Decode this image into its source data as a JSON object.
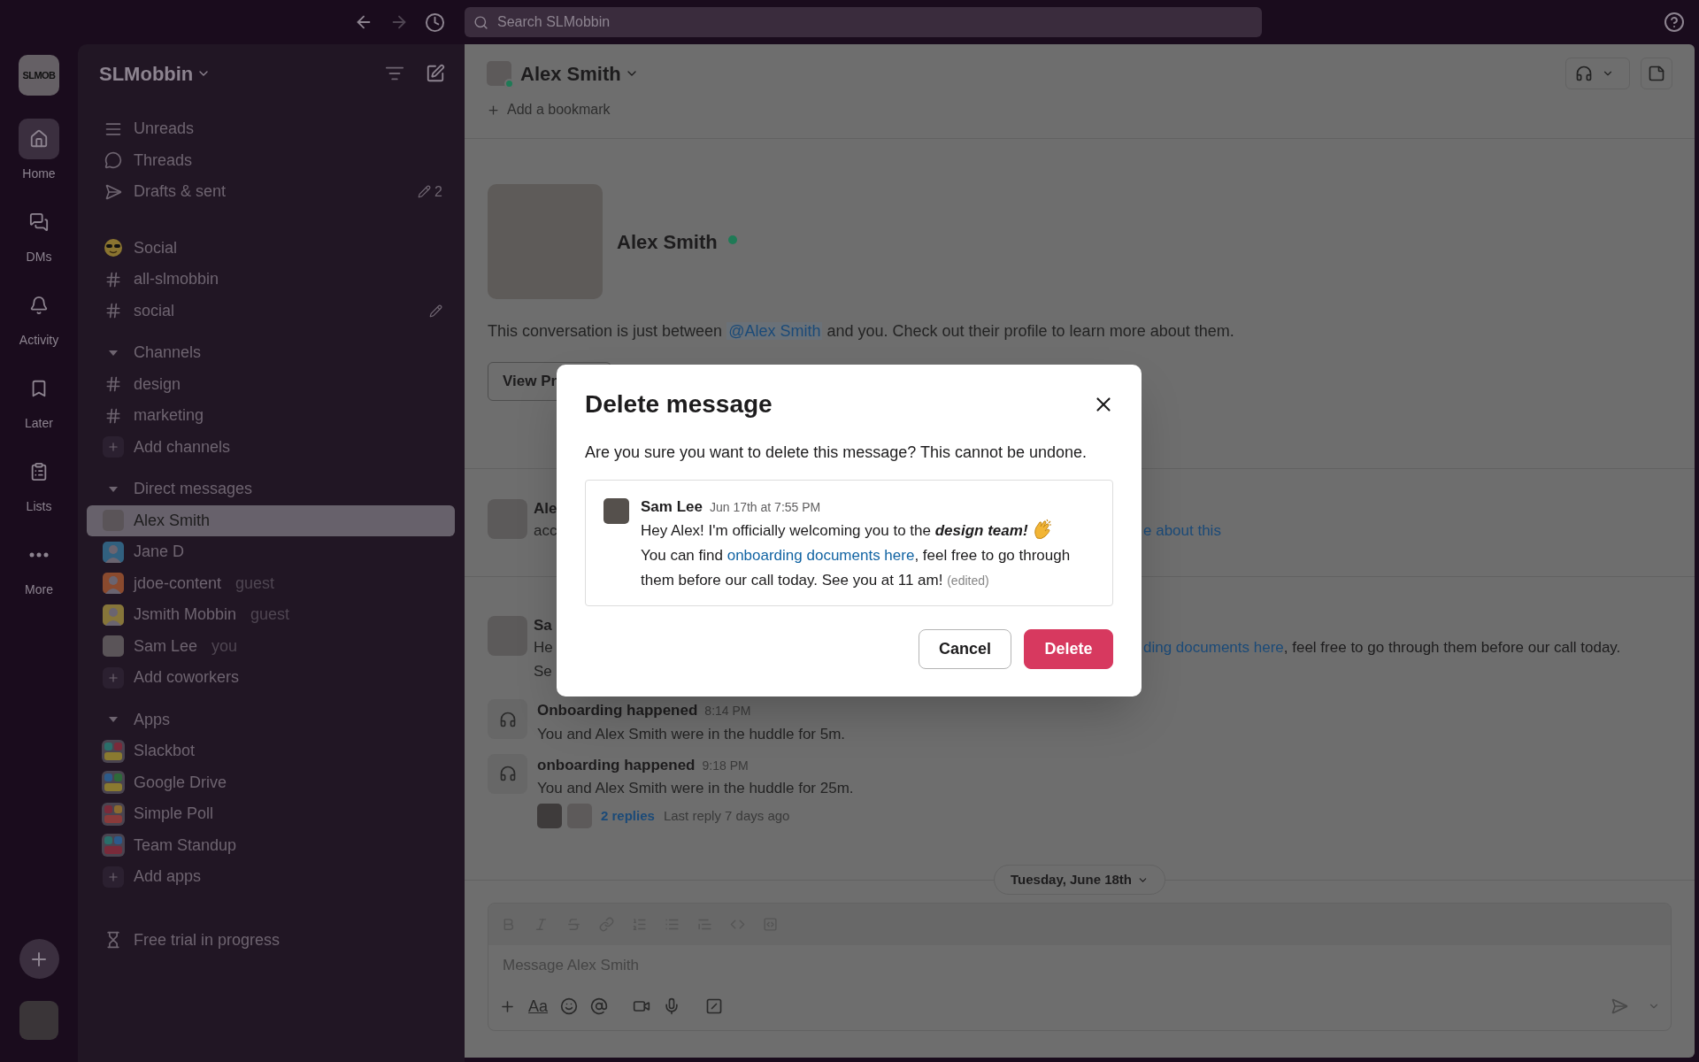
{
  "top_bar": {
    "search": {
      "placeholder": "Search SLMobbin"
    }
  },
  "rail": {
    "workspace_logo": "SLMOB",
    "items": [
      {
        "label": "Home",
        "selected": true
      },
      {
        "label": "DMs",
        "selected": false
      },
      {
        "label": "Activity",
        "selected": false
      },
      {
        "label": "Later",
        "selected": false
      },
      {
        "label": "Lists",
        "selected": false
      },
      {
        "label": "More",
        "selected": false
      }
    ]
  },
  "sidebar": {
    "workspace": "SLMobbin",
    "nav": [
      {
        "label": "Unreads",
        "selected": false
      },
      {
        "label": "Threads",
        "selected": false
      },
      {
        "label": "Drafts & sent",
        "count": "2",
        "selected": false
      }
    ],
    "starred": [
      {
        "kind": "emoji",
        "label": "Social",
        "selected": false
      },
      {
        "kind": "channel",
        "label": "all-slmobbin",
        "selected": false
      },
      {
        "kind": "channel",
        "label": "social",
        "draft": true,
        "selected": false
      }
    ],
    "sections": [
      {
        "title": "Channels",
        "expanded": true,
        "items": [
          {
            "kind": "channel",
            "label": "design",
            "selected": false
          },
          {
            "kind": "channel",
            "label": "marketing",
            "selected": false
          },
          {
            "kind": "add",
            "label": "Add channels",
            "selected": false
          }
        ]
      },
      {
        "title": "Direct messages",
        "expanded": true,
        "items": [
          {
            "kind": "person",
            "label": "Alex Smith",
            "selected": true
          },
          {
            "kind": "person",
            "label": "Jane D",
            "color": "#31607f",
            "selected": false
          },
          {
            "kind": "person",
            "label": "jdoe-content",
            "tag": "guest",
            "color": "#8a4a2e",
            "selected": false
          },
          {
            "kind": "person",
            "label": "Jsmith Mobbin",
            "tag": "guest",
            "color": "#86753a",
            "selected": false
          },
          {
            "kind": "person",
            "label": "Sam Lee",
            "tag": "you",
            "selected": false
          },
          {
            "kind": "add",
            "label": "Add coworkers",
            "selected": false
          }
        ]
      },
      {
        "title": "Apps",
        "expanded": true,
        "items": [
          {
            "kind": "app",
            "label": "Slackbot",
            "selected": false
          },
          {
            "kind": "app",
            "label": "Google Drive",
            "selected": false
          },
          {
            "kind": "app",
            "label": "Simple Poll",
            "selected": false
          },
          {
            "kind": "app",
            "label": "Team Standup",
            "selected": false
          },
          {
            "kind": "add",
            "label": "Add apps",
            "selected": false
          }
        ]
      }
    ],
    "footer": "Free trial in progress"
  },
  "conversation": {
    "header": {
      "title": "Alex Smith",
      "online": true
    },
    "bookmark": "Add a bookmark",
    "profile": {
      "name": "Alex Smith",
      "online": true,
      "intro_start": "This conversation is just between ",
      "mention": "@Alex Smith",
      "intro_end": " and you. Check out their profile to learn more about them.",
      "button": "View Pr"
    },
    "messages": [
      {
        "author": "Ale",
        "lines": [
          "acc"
        ],
        "right_link": "e about this"
      },
      {
        "author": "Sa",
        "lines": [
          "He",
          "Se"
        ],
        "right_link": "ding documents here",
        "right_text": ", feel free to go through them before our call today."
      }
    ],
    "huddles": [
      {
        "title": "Onboarding happened",
        "time": "8:14 PM",
        "text": "You and Alex Smith were in the huddle for 5m."
      },
      {
        "title": "onboarding happened",
        "time": "9:18 PM",
        "text": "You and Alex Smith were in the huddle for 25m.",
        "replies": "2 replies",
        "last_reply": "Last reply 7 days ago"
      }
    ],
    "date_divider": "Tuesday, June 18th",
    "composer": {
      "placeholder": "Message Alex Smith",
      "format_label": "Aa"
    }
  },
  "modal": {
    "title": "Delete message",
    "body": "Are you sure you want to delete this message? This cannot be undone.",
    "preview": {
      "author": "Sam Lee",
      "time": "Jun 17th at 7:55 PM",
      "segments": [
        {
          "kind": "text",
          "text": "Hey Alex! I'm officially welcoming you to the "
        },
        {
          "kind": "emphasis",
          "text": "design team!"
        },
        {
          "kind": "emoji"
        },
        {
          "kind": "text",
          "text": " You can find "
        },
        {
          "kind": "link",
          "text": "onboarding documents here"
        },
        {
          "kind": "text",
          "text": ", feel free to go through them before our call today. See you at 11 am! "
        },
        {
          "kind": "note",
          "text": "(edited)"
        }
      ]
    },
    "buttons": [
      {
        "label": "Cancel",
        "kind": "secondary"
      },
      {
        "label": "Delete",
        "kind": "danger"
      }
    ]
  }
}
